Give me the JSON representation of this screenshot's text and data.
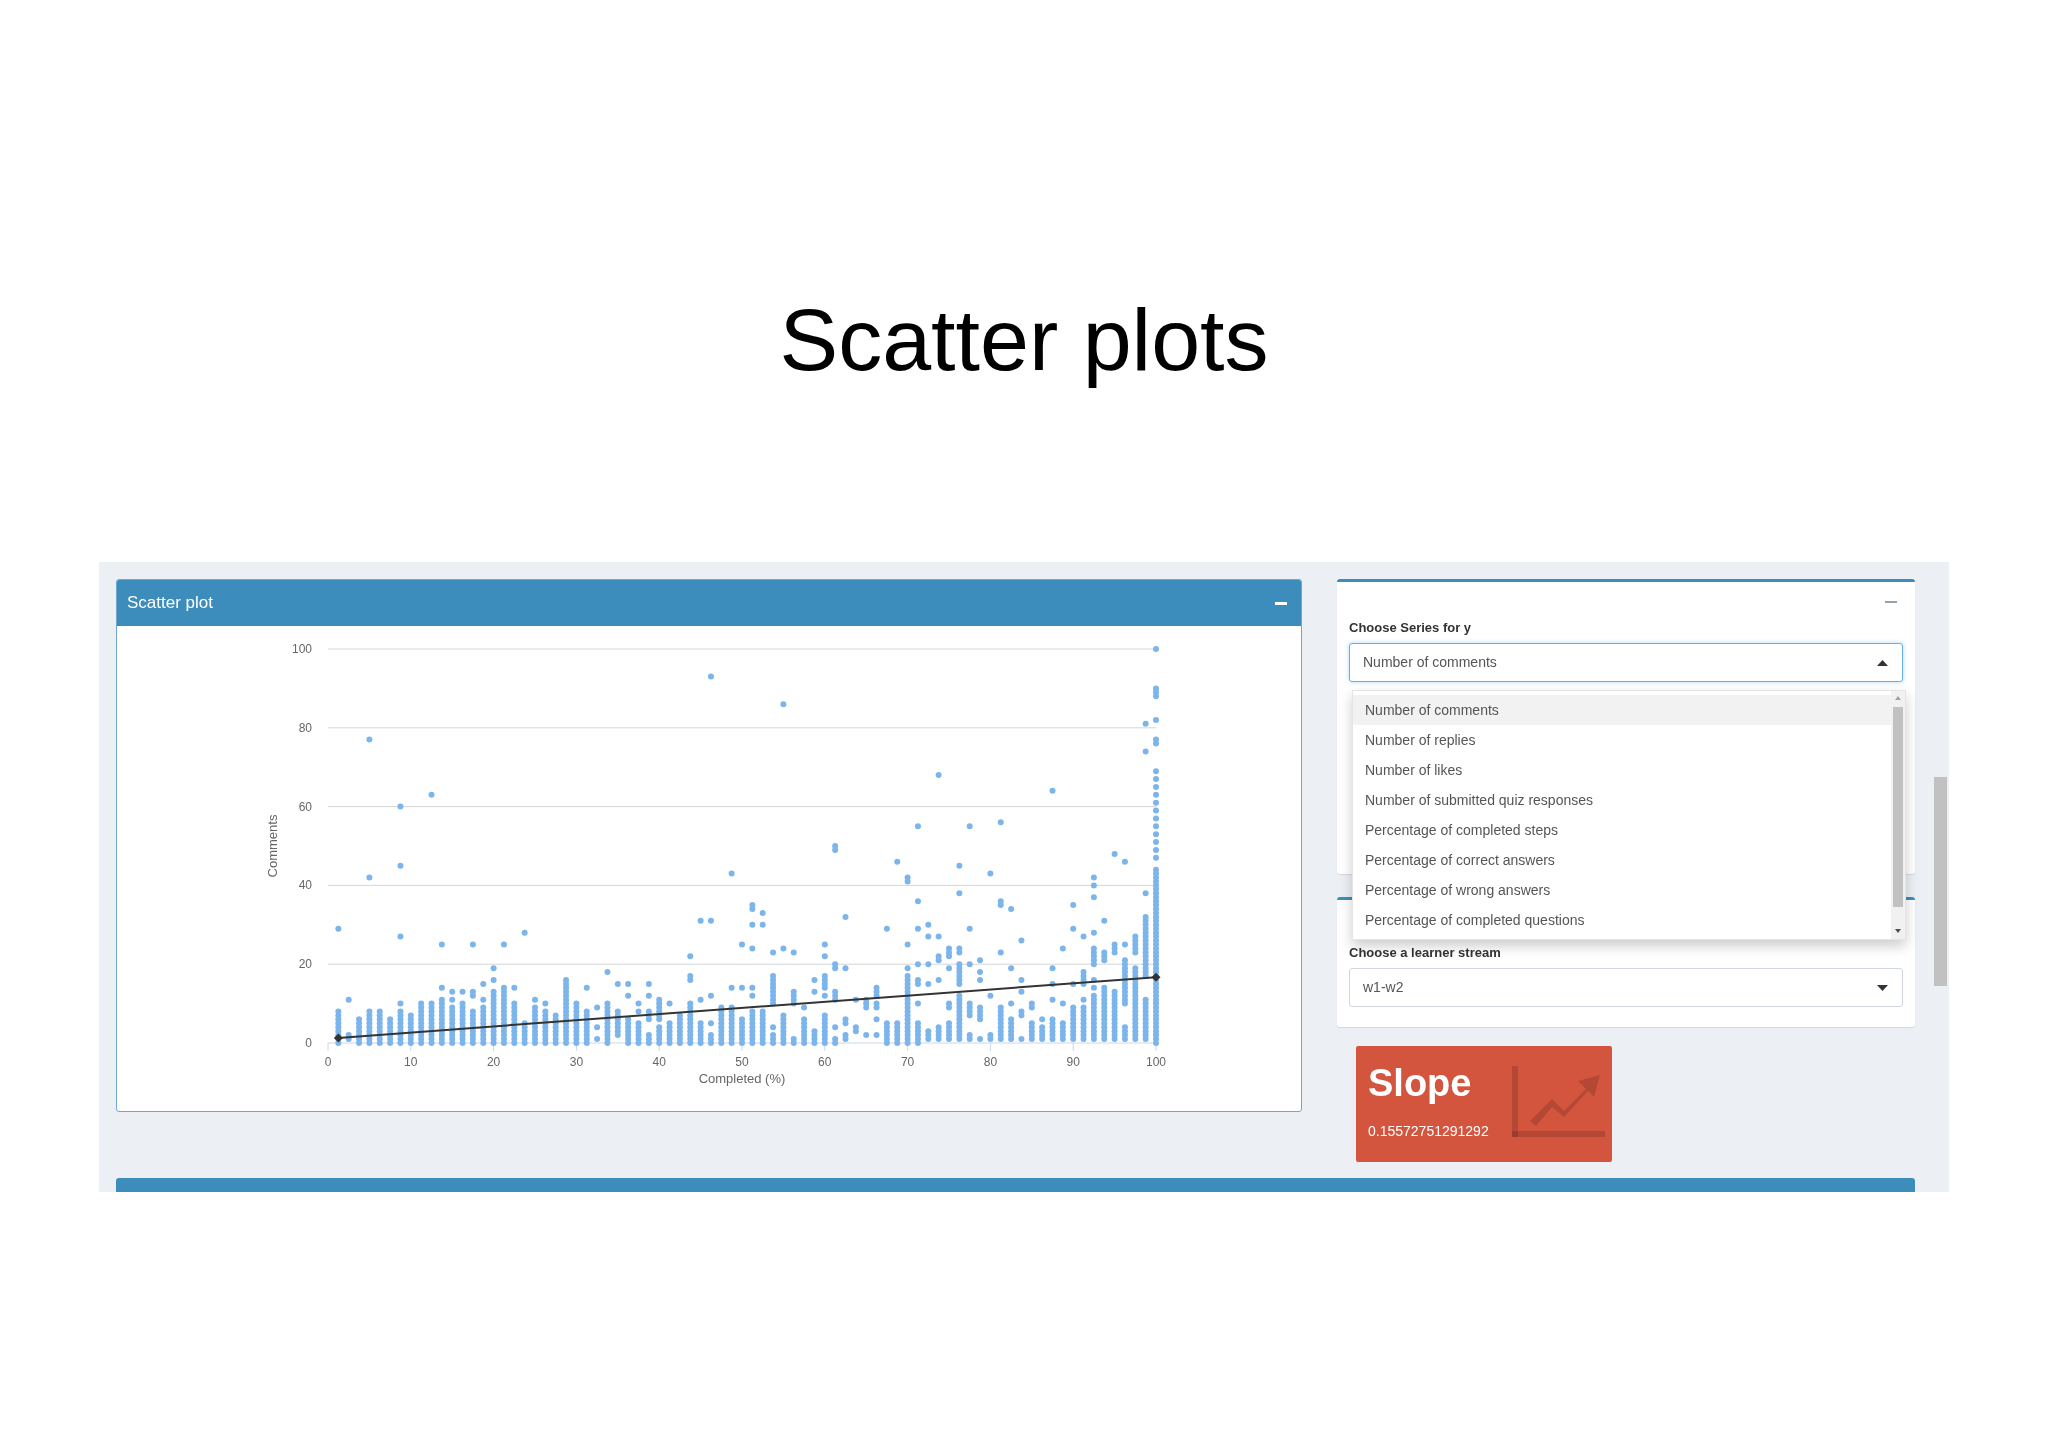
{
  "slide": {
    "title": "Scatter plots"
  },
  "scatter_panel": {
    "title": "Scatter plot",
    "chart_data": [
      {
        "type": "scatter",
        "xlabel": "Completed (%)",
        "ylabel": "Comments",
        "xlim": [
          0,
          100
        ],
        "ylim": [
          0,
          100
        ],
        "xticks": [
          0,
          10,
          20,
          30,
          40,
          50,
          60,
          70,
          80,
          90,
          100
        ],
        "yticks": [
          0,
          20,
          40,
          60,
          80,
          100
        ],
        "grid": "y",
        "series": [
          {
            "type": "scatter",
            "color": "#7cb5ec",
            "x": [
              1.25,
              1.25,
              1.25,
              1.25,
              1.25,
              1.25,
              1.25,
              1.25,
              1.25,
              1.25,
              2.5,
              2.5,
              2.5,
              3.75,
              3.75,
              3.75,
              3.75,
              3.75,
              3.75,
              3.75,
              5,
              5,
              5,
              5,
              5,
              5,
              5,
              5,
              5,
              5,
              5,
              6.25,
              6.25,
              6.25,
              6.25,
              6.25,
              6.25,
              6.25,
              6.25,
              6.25,
              7.5,
              7.5,
              7.5,
              7.5,
              7.5,
              7.5,
              7.5,
              8.75,
              8.75,
              8.75,
              8.75,
              8.75,
              8.75,
              8.75,
              8.75,
              8.75,
              8.75,
              8.75,
              8.75,
              8.75,
              10,
              10,
              10,
              10,
              10,
              10,
              10,
              10,
              11.25,
              11.25,
              11.25,
              11.25,
              11.25,
              11.25,
              11.25,
              11.25,
              11.25,
              11.25,
              11.25,
              12.5,
              12.5,
              12.5,
              12.5,
              12.5,
              12.5,
              12.5,
              12.5,
              12.5,
              12.5,
              12.5,
              12.5,
              13.75,
              13.75,
              13.75,
              13.75,
              13.75,
              13.75,
              13.75,
              13.75,
              13.75,
              13.75,
              13.75,
              13.75,
              13.75,
              13.75,
              15,
              15,
              15,
              15,
              15,
              15,
              15,
              15,
              15,
              15,
              15,
              15,
              16.25,
              16.25,
              16.25,
              16.25,
              16.25,
              16.25,
              16.25,
              16.25,
              16.25,
              16.25,
              16.25,
              16.25,
              17.5,
              17.5,
              17.5,
              17.5,
              17.5,
              17.5,
              17.5,
              17.5,
              17.5,
              17.5,
              17.5,
              17.5,
              18.75,
              18.75,
              18.75,
              18.75,
              18.75,
              18.75,
              18.75,
              18.75,
              18.75,
              18.75,
              18.75,
              18.75,
              20,
              20,
              20,
              20,
              20,
              20,
              20,
              20,
              20,
              20,
              20,
              20,
              20,
              20,
              20,
              20,
              21.25,
              21.25,
              21.25,
              21.25,
              21.25,
              21.25,
              21.25,
              21.25,
              21.25,
              21.25,
              21.25,
              21.25,
              21.25,
              21.25,
              21.25,
              21.25,
              22.5,
              22.5,
              22.5,
              22.5,
              22.5,
              22.5,
              22.5,
              22.5,
              22.5,
              22.5,
              22.5,
              22.5,
              23.75,
              23.75,
              23.75,
              23.75,
              23.75,
              23.75,
              23.75,
              25,
              25,
              25,
              25,
              25,
              25,
              25,
              25,
              25,
              25,
              25,
              26.25,
              26.25,
              26.25,
              26.25,
              26.25,
              26.25,
              26.25,
              26.25,
              26.25,
              26.25,
              27.5,
              27.5,
              27.5,
              27.5,
              27.5,
              27.5,
              27.5,
              27.5,
              28.75,
              28.75,
              28.75,
              28.75,
              28.75,
              28.75,
              28.75,
              28.75,
              28.75,
              28.75,
              28.75,
              28.75,
              28.75,
              28.75,
              28.75,
              28.75,
              28.75,
              30,
              30,
              30,
              30,
              30,
              30,
              30,
              30,
              30,
              30,
              30,
              31.25,
              31.25,
              31.25,
              31.25,
              31.25,
              31.25,
              31.25,
              31.25,
              31.25,
              31.25,
              32.5,
              32.5,
              32.5,
              33.75,
              33.75,
              33.75,
              33.75,
              33.75,
              33.75,
              33.75,
              33.75,
              33.75,
              33.75,
              33.75,
              33.75,
              35,
              35,
              35,
              35,
              35,
              35,
              35,
              35,
              36.25,
              36.25,
              36.25,
              36.25,
              36.25,
              36.25,
              36.25,
              36.25,
              36.25,
              37.5,
              37.5,
              37.5,
              37.5,
              37.5,
              37.5,
              37.5,
              37.5,
              38.75,
              38.75,
              38.75,
              38.75,
              38.75,
              38.75,
              38.75,
              38.75,
              40,
              40,
              40,
              40,
              40,
              40,
              40,
              40,
              40,
              40,
              40,
              41.25,
              41.25,
              41.25,
              41.25,
              41.25,
              41.25,
              41.25,
              42.5,
              42.5,
              42.5,
              42.5,
              42.5,
              42.5,
              42.5,
              42.5,
              43.75,
              43.75,
              43.75,
              43.75,
              43.75,
              43.75,
              43.75,
              43.75,
              43.75,
              43.75,
              43.75,
              43.75,
              43.75,
              43.75,
              45,
              45,
              45,
              45,
              45,
              45,
              45,
              45,
              46.25,
              46.25,
              46.25,
              46.25,
              46.25,
              46.25,
              46.25,
              47.5,
              47.5,
              47.5,
              47.5,
              47.5,
              47.5,
              47.5,
              47.5,
              47.5,
              47.5,
              48.75,
              48.75,
              48.75,
              48.75,
              48.75,
              48.75,
              48.75,
              48.75,
              48.75,
              48.75,
              48.75,
              48.75,
              50,
              50,
              50,
              50,
              50,
              50,
              50,
              50,
              50,
              51.25,
              51.25,
              51.25,
              51.25,
              51.25,
              51.25,
              51.25,
              51.25,
              51.25,
              51.25,
              51.25,
              51.25,
              51.25,
              51.25,
              51.25,
              52.5,
              52.5,
              52.5,
              52.5,
              52.5,
              52.5,
              52.5,
              52.5,
              52.5,
              52.5,
              52.5,
              53.75,
              53.75,
              53.75,
              53.75,
              53.75,
              53.75,
              53.75,
              53.75,
              53.75,
              53.75,
              53.75,
              53.75,
              53.75,
              55,
              55,
              55,
              55,
              55,
              55,
              55,
              55,
              55,
              55,
              56.25,
              56.25,
              56.25,
              56.25,
              56.25,
              56.25,
              56.25,
              57.5,
              57.5,
              57.5,
              57.5,
              57.5,
              57.5,
              57.5,
              57.5,
              58.75,
              58.75,
              58.75,
              58.75,
              58.75,
              58.75,
              60,
              60,
              60,
              60,
              60,
              60,
              60,
              60,
              60,
              60,
              60,
              60,
              60,
              60,
              60,
              61.25,
              61.25,
              61.25,
              61.25,
              61.25,
              61.25,
              61.25,
              61.25,
              61.25,
              61.25,
              62.5,
              62.5,
              62.5,
              62.5,
              62.5,
              62.5,
              63.75,
              63.75,
              63.75,
              65,
              65,
              65,
              65,
              66.25,
              66.25,
              66.25,
              66.25,
              66.25,
              66.25,
              66.25,
              67.5,
              67.5,
              67.5,
              67.5,
              67.5,
              67.5,
              67.5,
              68.75,
              68.75,
              68.75,
              68.75,
              68.75,
              68.75,
              68.75,
              70,
              70,
              70,
              70,
              70,
              70,
              70,
              70,
              70,
              70,
              70,
              70,
              70,
              70,
              70,
              70,
              70,
              70,
              70,
              70,
              70,
              70,
              71.25,
              71.25,
              71.25,
              71.25,
              71.25,
              71.25,
              71.25,
              71.25,
              71.25,
              71.25,
              71.25,
              71.25,
              71.25,
              72.5,
              72.5,
              72.5,
              72.5,
              72.5,
              72.5,
              72.5,
              73.75,
              73.75,
              73.75,
              73.75,
              73.75,
              73.75,
              73.75,
              73.75,
              73.75,
              75,
              75,
              75,
              75,
              75,
              75,
              75,
              75,
              75,
              75,
              75,
              76.25,
              76.25,
              76.25,
              76.25,
              76.25,
              76.25,
              76.25,
              76.25,
              76.25,
              76.25,
              76.25,
              76.25,
              76.25,
              76.25,
              76.25,
              76.25,
              76.25,
              76.25,
              76.25,
              76.25,
              76.25,
              76.25,
              77.5,
              77.5,
              77.5,
              77.5,
              77.5,
              77.5,
              77.5,
              77.5,
              77.5,
              78.75,
              78.75,
              78.75,
              78.75,
              78.75,
              78.75,
              78.75,
              78.75,
              80,
              80,
              80,
              80,
              81.25,
              81.25,
              81.25,
              81.25,
              81.25,
              81.25,
              81.25,
              81.25,
              81.25,
              81.25,
              81.25,
              81.25,
              81.25,
              82.5,
              82.5,
              82.5,
              82.5,
              82.5,
              82.5,
              82.5,
              82.5,
              82.5,
              83.75,
              83.75,
              83.75,
              83.75,
              83.75,
              83.75,
              85,
              85,
              85,
              85,
              85,
              85,
              85,
              86.25,
              86.25,
              86.25,
              86.25,
              86.25,
              87.5,
              87.5,
              87.5,
              87.5,
              87.5,
              87.5,
              87.5,
              87.5,
              87.5,
              87.5,
              88.75,
              88.75,
              88.75,
              88.75,
              88.75,
              88.75,
              88.75,
              90,
              90,
              90,
              90,
              90,
              90,
              90,
              90,
              90,
              90,
              90,
              90,
              91.25,
              91.25,
              91.25,
              91.25,
              91.25,
              91.25,
              91.25,
              91.25,
              91.25,
              91.25,
              91.25,
              91.25,
              91.25,
              91.25,
              91.25,
              92.5,
              92.5,
              92.5,
              92.5,
              92.5,
              92.5,
              92.5,
              92.5,
              92.5,
              92.5,
              92.5,
              92.5,
              92.5,
              92.5,
              92.5,
              92.5,
              92.5,
              92.5,
              92.5,
              92.5,
              92.5,
              92.5,
              92.5,
              93.75,
              93.75,
              93.75,
              93.75,
              93.75,
              93.75,
              93.75,
              93.75,
              93.75,
              93.75,
              93.75,
              93.75,
              93.75,
              93.75,
              93.75,
              93.75,
              93.75,
              93.75,
              95,
              95,
              95,
              95,
              95,
              95,
              95,
              95,
              95,
              95,
              95,
              95,
              95,
              95,
              95,
              95,
              95,
              96.25,
              96.25,
              96.25,
              96.25,
              96.25,
              96.25,
              96.25,
              96.25,
              96.25,
              96.25,
              96.25,
              96.25,
              96.25,
              96.25,
              96.25,
              96.25,
              96.25,
              96.25,
              97.5,
              97.5,
              97.5,
              97.5,
              97.5,
              97.5,
              97.5,
              97.5,
              97.5,
              97.5,
              97.5,
              97.5,
              97.5,
              97.5,
              97.5,
              97.5,
              97.5,
              97.5,
              97.5,
              97.5,
              97.5,
              97.5,
              97.5,
              97.5,
              98.75,
              98.75,
              98.75,
              98.75,
              98.75,
              98.75,
              98.75,
              98.75,
              98.75,
              98.75,
              98.75,
              98.75,
              98.75,
              98.75,
              98.75,
              98.75,
              98.75,
              98.75,
              98.75,
              98.75,
              98.75,
              98.75,
              98.75,
              98.75,
              98.75,
              98.75,
              98.75,
              98.75,
              98.75,
              98.75,
              100,
              100,
              100,
              100,
              100,
              100,
              100,
              100,
              100,
              100,
              100,
              100,
              100,
              100,
              100,
              100,
              100,
              100,
              100,
              100,
              100,
              100,
              100,
              100,
              100,
              100,
              100,
              100,
              100,
              100,
              100,
              100,
              100,
              100,
              100,
              100,
              100,
              100,
              100,
              100,
              100,
              100,
              100,
              100,
              100,
              100,
              100,
              100,
              100,
              100,
              100,
              100,
              100,
              100,
              100,
              100,
              100,
              100,
              100,
              100,
              100,
              100,
              100,
              100
            ],
            "values": [
              0,
              1,
              2,
              3,
              4,
              5,
              6,
              7,
              8,
              29,
              1,
              2,
              11,
              0,
              1,
              2,
              3,
              4,
              5,
              6,
              0,
              1,
              2,
              3,
              4,
              5,
              6,
              7,
              8,
              42,
              77,
              0,
              1,
              2,
              3,
              4,
              5,
              6,
              7,
              8,
              0,
              1,
              2,
              3,
              4,
              5,
              6,
              0,
              1,
              2,
              3,
              4,
              5,
              6,
              7,
              8,
              10,
              27,
              45,
              60,
              0,
              1,
              2,
              3,
              4,
              5,
              6,
              7,
              0,
              1,
              2,
              3,
              4,
              5,
              6,
              7,
              8,
              9,
              10,
              0,
              1,
              2,
              3,
              4,
              5,
              6,
              7,
              8,
              9,
              10,
              63,
              0,
              1,
              2,
              3,
              4,
              5,
              6,
              7,
              8,
              9,
              10,
              11,
              14,
              25,
              0,
              1,
              2,
              3,
              4,
              5,
              6,
              7,
              8,
              9,
              11,
              13,
              0,
              1,
              2,
              3,
              4,
              5,
              6,
              7,
              8,
              9,
              10,
              13,
              0,
              1,
              2,
              3,
              4,
              5,
              6,
              7,
              8,
              12,
              13,
              25,
              0,
              1,
              2,
              3,
              4,
              5,
              6,
              7,
              8,
              9,
              11,
              15,
              0,
              1,
              2,
              3,
              4,
              5,
              6,
              7,
              8,
              9,
              10,
              11,
              12,
              13,
              16,
              19,
              0,
              1,
              2,
              3,
              4,
              5,
              6,
              7,
              8,
              9,
              10,
              11,
              12,
              13,
              14,
              25,
              0,
              1,
              2,
              3,
              4,
              5,
              6,
              7,
              8,
              9,
              10,
              14,
              0,
              1,
              2,
              3,
              4,
              5,
              28,
              0,
              1,
              2,
              3,
              4,
              5,
              6,
              7,
              8,
              9,
              11,
              0,
              1,
              2,
              3,
              4,
              5,
              6,
              7,
              8,
              10,
              0,
              1,
              2,
              3,
              4,
              5,
              6,
              7,
              0,
              1,
              2,
              3,
              4,
              5,
              6,
              7,
              8,
              9,
              10,
              11,
              12,
              13,
              14,
              15,
              16,
              0,
              1,
              2,
              3,
              4,
              5,
              6,
              7,
              8,
              9,
              10,
              0,
              1,
              2,
              3,
              4,
              5,
              6,
              7,
              8,
              14,
              1,
              4,
              9,
              0,
              1,
              2,
              3,
              4,
              5,
              6,
              7,
              8,
              9,
              10,
              18,
              2,
              3,
              4,
              5,
              6,
              7,
              8,
              15,
              0,
              1,
              2,
              3,
              4,
              5,
              6,
              12,
              15,
              0,
              1,
              2,
              3,
              4,
              5,
              8,
              10,
              0,
              1,
              2,
              6,
              7,
              8,
              12,
              15,
              0,
              1,
              2,
              3,
              4,
              6,
              7,
              8,
              9,
              10,
              11,
              0,
              1,
              2,
              3,
              4,
              5,
              10,
              0,
              1,
              2,
              3,
              4,
              5,
              6,
              7,
              0,
              1,
              2,
              3,
              4,
              5,
              6,
              7,
              8,
              9,
              10,
              16,
              17,
              22,
              0,
              1,
              2,
              3,
              4,
              5,
              11,
              31,
              0,
              1,
              2,
              5,
              12,
              31,
              93,
              0,
              1,
              2,
              3,
              4,
              5,
              6,
              7,
              8,
              9,
              0,
              1,
              2,
              3,
              4,
              5,
              6,
              7,
              8,
              9,
              14,
              43,
              0,
              1,
              2,
              3,
              4,
              5,
              6,
              14,
              25,
              0,
              1,
              2,
              3,
              4,
              5,
              6,
              7,
              8,
              12,
              14,
              24,
              30,
              34,
              35,
              0,
              1,
              2,
              3,
              4,
              5,
              6,
              7,
              8,
              30,
              33,
              0,
              1,
              2,
              4,
              10,
              11,
              12,
              13,
              14,
              15,
              16,
              17,
              23,
              0,
              1,
              2,
              3,
              4,
              5,
              6,
              7,
              24,
              86,
              0,
              1,
              10,
              11,
              12,
              13,
              23,
              0,
              1,
              2,
              3,
              4,
              5,
              6,
              9,
              0,
              1,
              2,
              3,
              13,
              16,
              0,
              1,
              2,
              3,
              4,
              5,
              6,
              7,
              12,
              14,
              15,
              16,
              17,
              22,
              25,
              0,
              1,
              4,
              11,
              12,
              13,
              19,
              20,
              49,
              50,
              1,
              2,
              5,
              6,
              19,
              32,
              3,
              4,
              11,
              2,
              9,
              10,
              11,
              2,
              6,
              9,
              10,
              12,
              13,
              14,
              0,
              1,
              2,
              3,
              4,
              5,
              29,
              0,
              1,
              2,
              3,
              4,
              5,
              46,
              0,
              1,
              2,
              3,
              4,
              5,
              6,
              7,
              8,
              9,
              10,
              11,
              12,
              13,
              14,
              15,
              16,
              17,
              19,
              25,
              41,
              42,
              0,
              1,
              2,
              3,
              4,
              5,
              10,
              15,
              16,
              20,
              29,
              36,
              55,
              1,
              2,
              3,
              15,
              20,
              27,
              30,
              1,
              2,
              3,
              4,
              16,
              21,
              22,
              27,
              68,
              1,
              2,
              3,
              4,
              5,
              9,
              10,
              19,
              22,
              23,
              24,
              1,
              2,
              3,
              4,
              5,
              6,
              7,
              8,
              9,
              10,
              11,
              12,
              15,
              16,
              17,
              18,
              19,
              20,
              23,
              24,
              38,
              45,
              1,
              2,
              7,
              8,
              9,
              10,
              20,
              29,
              55,
              1,
              6,
              7,
              8,
              9,
              16,
              18,
              21,
              1,
              2,
              12,
              43,
              1,
              2,
              3,
              4,
              5,
              6,
              7,
              8,
              9,
              23,
              35,
              36,
              56,
              1,
              2,
              3,
              4,
              5,
              6,
              10,
              19,
              34,
              1,
              7,
              8,
              13,
              16,
              26,
              1,
              2,
              3,
              4,
              5,
              9,
              10,
              1,
              2,
              3,
              4,
              6,
              1,
              2,
              3,
              4,
              5,
              6,
              11,
              15,
              19,
              64,
              1,
              2,
              3,
              4,
              5,
              10,
              24,
              1,
              2,
              3,
              4,
              5,
              6,
              7,
              8,
              9,
              15,
              29,
              35,
              1,
              2,
              3,
              4,
              5,
              6,
              7,
              8,
              9,
              11,
              15,
              16,
              17,
              18,
              27,
              1,
              2,
              3,
              4,
              5,
              6,
              7,
              8,
              9,
              10,
              11,
              12,
              14,
              16,
              20,
              21,
              22,
              23,
              24,
              28,
              37,
              40,
              42,
              1,
              2,
              3,
              4,
              5,
              6,
              7,
              8,
              9,
              10,
              11,
              12,
              13,
              14,
              21,
              22,
              23,
              31,
              1,
              2,
              3,
              4,
              5,
              6,
              7,
              8,
              9,
              10,
              11,
              12,
              13,
              23,
              24,
              25,
              48,
              1,
              2,
              3,
              4,
              10,
              11,
              12,
              13,
              14,
              15,
              16,
              17,
              18,
              19,
              20,
              21,
              25,
              46,
              1,
              2,
              3,
              4,
              5,
              6,
              7,
              8,
              9,
              10,
              11,
              12,
              13,
              14,
              15,
              16,
              17,
              18,
              19,
              23,
              24,
              25,
              26,
              27,
              1,
              2,
              3,
              4,
              5,
              6,
              7,
              8,
              9,
              10,
              11,
              17,
              18,
              19,
              20,
              21,
              22,
              23,
              24,
              25,
              26,
              27,
              28,
              29,
              30,
              31,
              32,
              38,
              74,
              81,
              0,
              1,
              2,
              3,
              4,
              5,
              6,
              7,
              8,
              9,
              10,
              11,
              12,
              13,
              14,
              15,
              16,
              17,
              18,
              19,
              20,
              21,
              22,
              23,
              24,
              25,
              26,
              27,
              28,
              29,
              30,
              31,
              32,
              33,
              34,
              35,
              36,
              37,
              38,
              39,
              40,
              41,
              42,
              43,
              44,
              47,
              49,
              51,
              53,
              55,
              57,
              59,
              61,
              63,
              65,
              67,
              69,
              76,
              77,
              82,
              88,
              89,
              90,
              100
            ]
          },
          {
            "type": "line",
            "color": "#333333",
            "marker": "diamond",
            "x": [
              1.25,
              100
            ],
            "values": [
              1.3,
              16.7
            ]
          }
        ]
      }
    ]
  },
  "series_panel": {
    "label": "Choose Series for y",
    "select": {
      "value": "Number of comments",
      "expanded": true
    },
    "options": [
      {
        "label": "Number of comments",
        "selected": true
      },
      {
        "label": "Number of replies",
        "selected": false
      },
      {
        "label": "Number of likes",
        "selected": false
      },
      {
        "label": "Number of submitted quiz responses",
        "selected": false
      },
      {
        "label": "Percentage of completed steps",
        "selected": false
      },
      {
        "label": "Percentage of correct answers",
        "selected": false
      },
      {
        "label": "Percentage of wrong answers",
        "selected": false
      },
      {
        "label": "Percentage of completed questions",
        "selected": false
      }
    ]
  },
  "stream_panel": {
    "label": "Choose a learner stream",
    "select": {
      "value": "w1-w2",
      "expanded": false
    }
  },
  "slope_box": {
    "title": "Slope",
    "value": "0.15572751291292"
  }
}
